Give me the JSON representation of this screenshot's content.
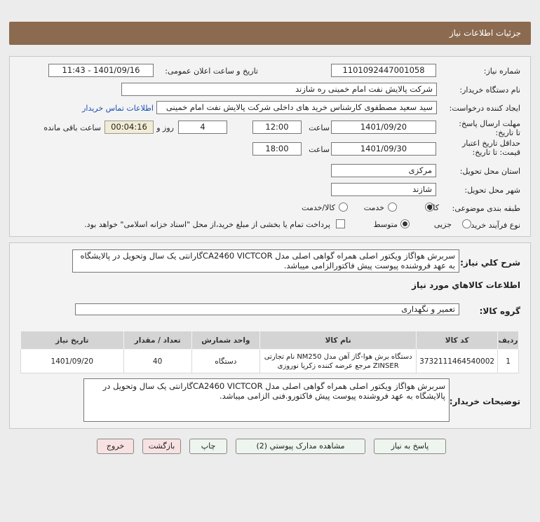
{
  "header": {
    "title": "جزئیات اطلاعات نیاز"
  },
  "labels": {
    "need_number": "شماره نیاز:",
    "announce_datetime": "تاریخ و ساعت اعلان عمومی:",
    "buyer_org": "نام دستگاه خریدار:",
    "requester": "ایجاد کننده درخواست:",
    "reply_deadline": "مهلت ارسال پاسخ: تا تاریخ:",
    "time": "ساعت",
    "days_and": "روز و",
    "remaining": "ساعت باقی مانده",
    "price_validity": "حداقل تاریخ اعتبار قیمت: تا تاریخ:",
    "delivery_province": "استان محل تحویل:",
    "delivery_city": "شهر محل تحویل:",
    "category": "طبقه بندی موضوعی:",
    "process_type": "نوع فرآیند خرید :",
    "general_desc": "شرح کلي نياز:",
    "goods_info": "اطلاعات کالاهاي مورد نياز",
    "goods_group": "گروه کالا:",
    "buyer_notes": "توضیحات خریدار:"
  },
  "fields": {
    "need_number": "1101092447001058",
    "announce_datetime": "1401/09/16 - 11:43",
    "buyer_org": "شرکت پالایش نفت امام خمینی  ره  شازند",
    "requester": "سید سعید مصطفوی کارشناس خرید های داخلی شرکت پالایش نفت امام خمینی",
    "contact_link": "اطلاعات تماس خریدار",
    "reply_date": "1401/09/20",
    "reply_time": "12:00",
    "days": "4",
    "remaining_time": "00:04:16",
    "validity_date": "1401/09/30",
    "validity_time": "18:00",
    "province": "مرکزی",
    "city": "شازند"
  },
  "category_options": [
    {
      "label": "کالا",
      "selected": true
    },
    {
      "label": "خدمت",
      "selected": false
    },
    {
      "label": "کالا/خدمت",
      "selected": false
    }
  ],
  "process_options": [
    {
      "label": "جزیی",
      "selected": false
    },
    {
      "label": "متوسط",
      "selected": true
    }
  ],
  "payment_note": "پرداخت تمام یا بخشی از مبلغ خرید،از محل \"اسناد خزانه اسلامی\" خواهد بود.",
  "general_desc_text": "سربرش هواگاز ویکتور اصلی همراه گواهی اصلی مدل CA2460 VICTCORگارانتی یک سال وتحویل در پالایشگاه به عهد فروشنده پیوست پیش فاکتورالزامی میباشد.",
  "goods_group_value": "تعمیر و نگهداری",
  "table": {
    "headers": [
      "ردیف",
      "کد کالا",
      "نام کالا",
      "واحد شمارش",
      "تعداد / مقدار",
      "تاریخ نیاز"
    ],
    "rows": [
      {
        "row": "1",
        "code": "3732111464540002",
        "name": "دستگاه برش هوا-گاز آهن مدل NM250 نام تجارتی ZINSER مرجع عرضه کننده زکریا نوروزی",
        "unit": "دستگاه",
        "qty": "40",
        "date": "1401/09/20"
      }
    ]
  },
  "buyer_notes_text": "سربرش هواگاز ویکتور اصلی همراه گواهی اصلی مدل CA2460 VICTCORگارانتی یک سال وتحویل در پالایشگاه به عهد فروشنده پیوست پیش فاکتورو.فنی  الزامی میباشد.",
  "buttons": {
    "reply": "پاسخ به نیاز",
    "attachments": "مشاهده مدارک پیوستي (2)",
    "print": "چاپ",
    "back": "بازگشت",
    "exit": "خروج"
  },
  "colors": {
    "header_bg": "#8b6a4f",
    "link": "#1a4fb5"
  }
}
